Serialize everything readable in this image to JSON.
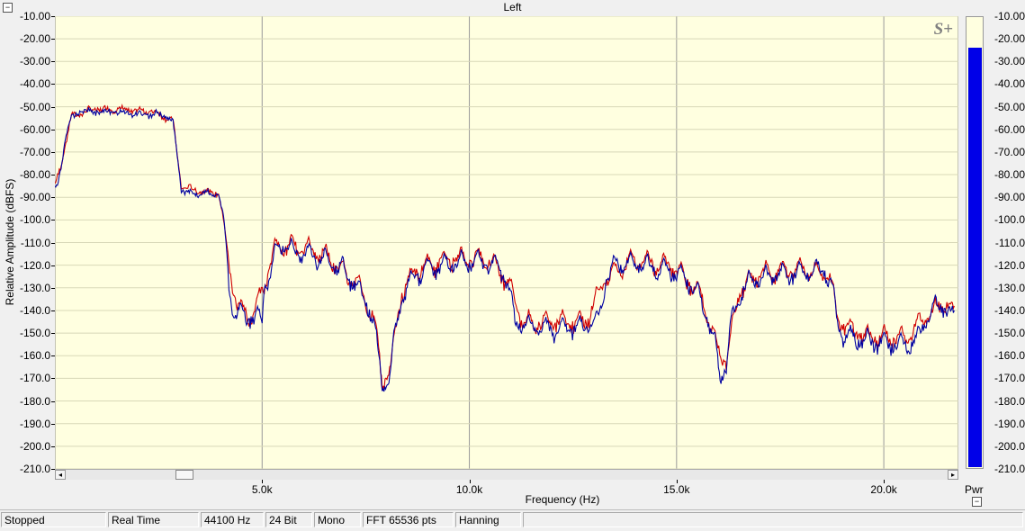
{
  "window": {
    "title": "Left"
  },
  "controls": {
    "collapse_top": "−",
    "collapse_meter": "−"
  },
  "chart_data": {
    "type": "line",
    "title": "Left",
    "xlabel": "Frequency (Hz)",
    "ylabel": "Relative Amplitude (dBFS)",
    "xlim": [
      0,
      21800
    ],
    "ylim": [
      -210,
      -10
    ],
    "x_ticks": [
      5000,
      10000,
      15000,
      20000
    ],
    "x_tick_labels": [
      "5.0k",
      "10.0k",
      "15.0k",
      "20.0k"
    ],
    "y_ticks": [
      -10,
      -20,
      -30,
      -40,
      -50,
      -60,
      -70,
      -80,
      -90,
      -100,
      -110,
      -120,
      -130,
      -140,
      -150,
      -160,
      -170,
      -180,
      -190,
      -200,
      -210
    ],
    "y_tick_labels": [
      "-10.00",
      "-20.00",
      "-30.00",
      "-40.00",
      "-50.00",
      "-60.00",
      "-70.00",
      "-80.00",
      "-90.00",
      "-100.0",
      "-110.0",
      "-120.0",
      "-130.0",
      "-140.0",
      "-150.0",
      "-160.0",
      "-170.0",
      "-180.0",
      "-190.0",
      "-200.0",
      "-210.0"
    ],
    "grid": true,
    "background_color": "#ffffe0",
    "grid_color": "#999999",
    "series": [
      {
        "color": "#0000a0",
        "x": [
          0,
          80,
          150,
          250,
          400,
          600,
          900,
          1200,
          1600,
          2000,
          2400,
          2700,
          2850,
          2950,
          3050,
          3200,
          3500,
          3800,
          3950,
          4050,
          4150,
          4200,
          4300,
          4400,
          4600,
          4800,
          5000,
          5050,
          5200,
          5350,
          5500,
          5700,
          6000,
          6500,
          7000,
          7300,
          7500,
          7700,
          7800,
          7900,
          8000,
          8100,
          8200,
          8350,
          8500,
          8700,
          9000,
          9500,
          10000,
          10500,
          10800,
          10950,
          11100,
          11300,
          12000,
          12800,
          13100,
          13300,
          13500,
          14000,
          14500,
          15000,
          15300,
          15600,
          15800,
          15950,
          16050,
          16200,
          16300,
          16500,
          16700,
          17000,
          17500,
          18000,
          18600,
          18700,
          18800,
          18900,
          19000,
          19500,
          20000,
          20500,
          20800,
          21000,
          21200,
          21500,
          21700
        ],
        "values": [
          -85,
          -82,
          -75,
          -62,
          -54,
          -51,
          -51,
          -51,
          -51,
          -52,
          -52,
          -53,
          -56,
          -70,
          -85,
          -87,
          -87,
          -87,
          -88,
          -96,
          -110,
          -125,
          -133,
          -136,
          -137,
          -138,
          -139,
          -125,
          -118,
          -108,
          -105,
          -108,
          -110,
          -112,
          -117,
          -125,
          -130,
          -140,
          -155,
          -167,
          -168,
          -162,
          -145,
          -130,
          -125,
          -119,
          -116,
          -114,
          -113,
          -114,
          -117,
          -125,
          -140,
          -142,
          -143,
          -142,
          -140,
          -122,
          -114,
          -114,
          -116,
          -118,
          -122,
          -130,
          -142,
          -152,
          -165,
          -160,
          -142,
          -128,
          -123,
          -121,
          -119,
          -118,
          -117,
          -122,
          -130,
          -142,
          -146,
          -148,
          -149,
          -150,
          -148,
          -140,
          -133,
          -133,
          -140
        ]
      },
      {
        "color": "#d00000",
        "x": [
          0,
          150,
          400,
          900,
          1600,
          2400,
          2850,
          3050,
          3500,
          3950,
          4150,
          4400,
          4800,
          5050,
          5350,
          5700,
          6500,
          7300,
          7700,
          7900,
          8100,
          8350,
          8700,
          9500,
          10500,
          10950,
          11300,
          12800,
          13300,
          14000,
          15000,
          15600,
          15950,
          16200,
          16500,
          17000,
          18000,
          18700,
          18900,
          19500,
          20500,
          21000,
          21500,
          21700
        ],
        "values": [
          -84,
          -74,
          -53,
          -50,
          -50,
          -51,
          -55,
          -84,
          -86,
          -87,
          -108,
          -134,
          -137,
          -123,
          -106,
          -106,
          -110,
          -123,
          -138,
          -166,
          -160,
          -128,
          -117,
          -112,
          -112,
          -123,
          -140,
          -140,
          -120,
          -112,
          -116,
          -128,
          -150,
          -158,
          -126,
          -119,
          -116,
          -120,
          -140,
          -146,
          -147,
          -138,
          -131,
          -138
        ]
      }
    ]
  },
  "scrollbar": {
    "left_arrow": "◂",
    "right_arrow": "▸"
  },
  "meter": {
    "label": "Pwr",
    "value_db": -24,
    "range": [
      -210,
      -10
    ],
    "bar_color": "#0000e8",
    "tick_labels": [
      "-10.00",
      "-20.00",
      "-30.00",
      "-40.00",
      "-50.00",
      "-60.00",
      "-70.00",
      "-80.00",
      "-90.00",
      "-100.0",
      "-110.0",
      "-120.0",
      "-130.0",
      "-140.0",
      "-150.0",
      "-160.0",
      "-170.0",
      "-180.0",
      "-190.0",
      "-200.0",
      "-210.0"
    ]
  },
  "logo_text": "S+",
  "status_bar": {
    "state": "Stopped",
    "mode": "Real Time",
    "sample_rate": "44100 Hz",
    "bit_depth": "24 Bit",
    "channels": "Mono",
    "fft_size": "FFT 65536 pts",
    "window_fn": "Hanning"
  }
}
